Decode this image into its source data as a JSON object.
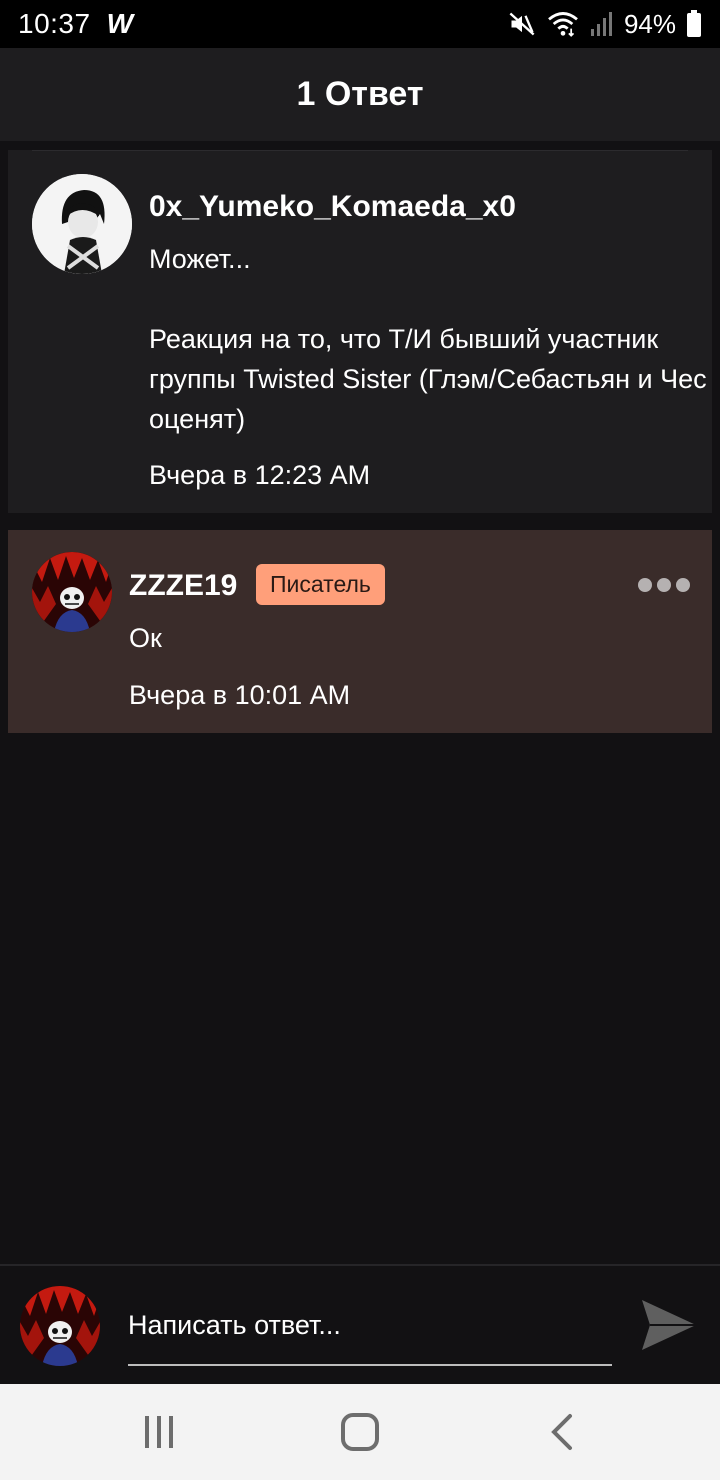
{
  "status_bar": {
    "time": "10:37",
    "app_icon": "W",
    "battery": "94%"
  },
  "header": {
    "title": "1 Ответ"
  },
  "parent_comment": {
    "author": "0x_Yumeko_Komaeda_x0",
    "body": "Может...\n\nРеакция на то, что Т/И бывший участник группы Twisted Sister (Глэм/Себастьян и Чес оценят)",
    "time": "Вчера в 12:23 AM"
  },
  "reply": {
    "author": "ZZZE19",
    "badge": "Писатель",
    "body": "Ок",
    "time": "Вчера в 10:01 AM"
  },
  "compose": {
    "placeholder": "Написать ответ..."
  },
  "colors": {
    "background": "#121113",
    "card": "#1e1d1f",
    "highlight_card": "#3a2c2a",
    "badge": "#ff9f7a"
  }
}
